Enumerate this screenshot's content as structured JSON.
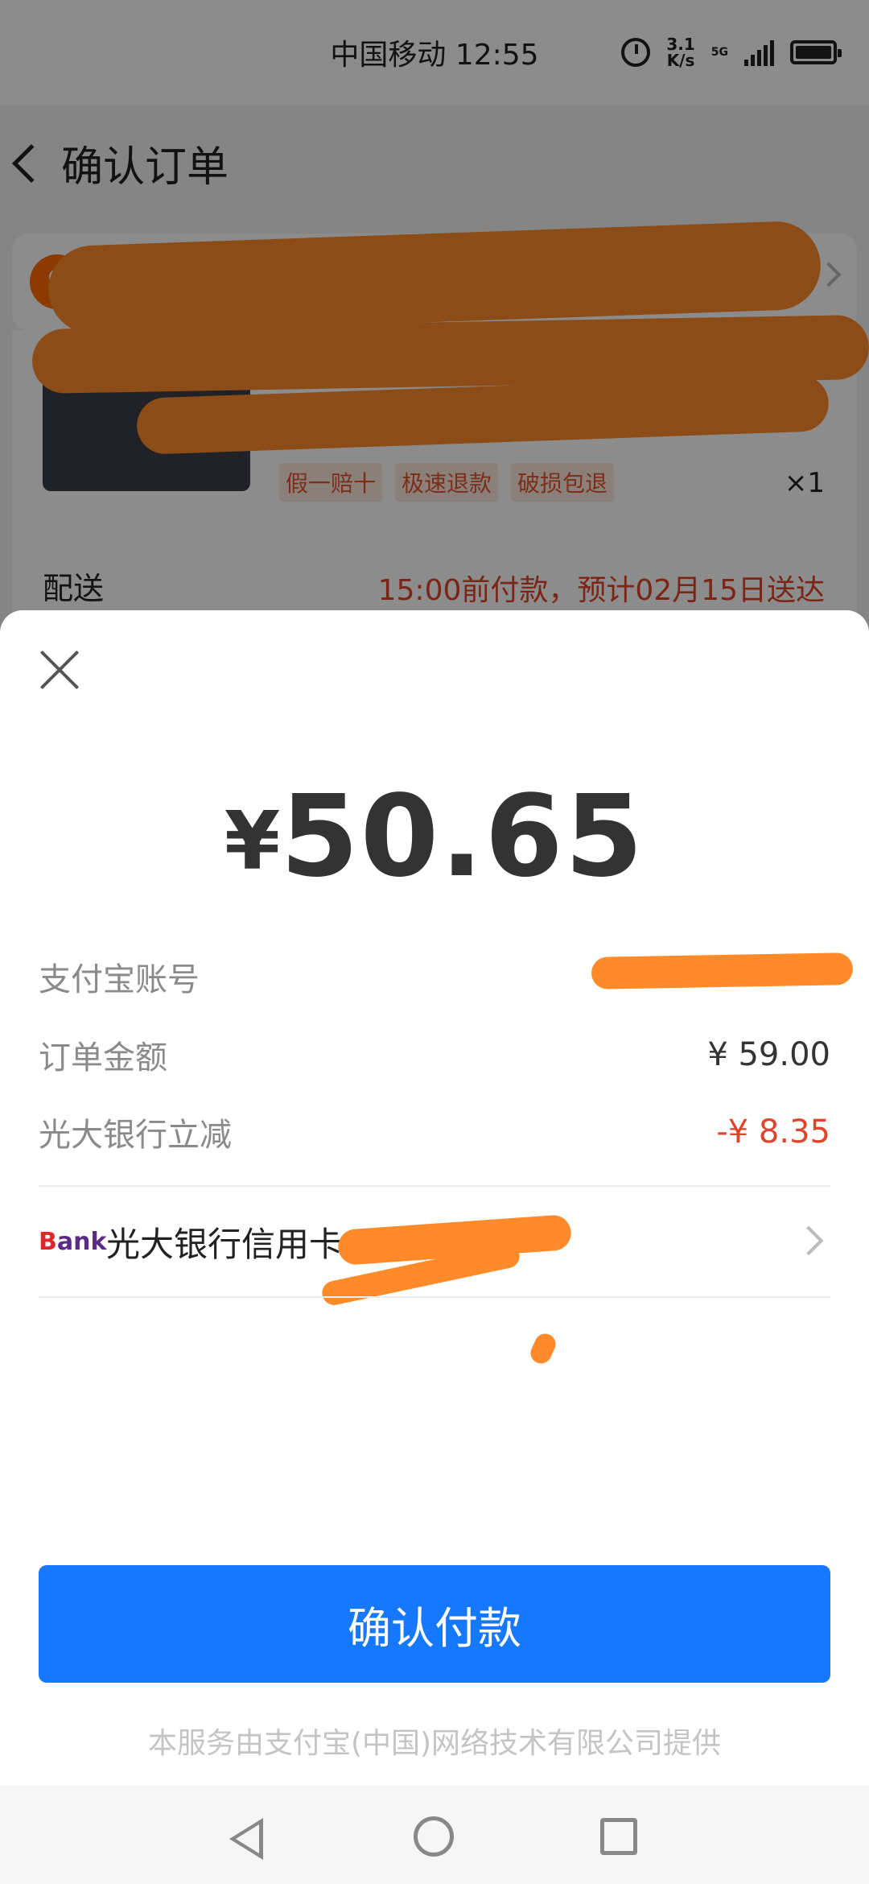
{
  "status_bar": {
    "carrier_time": "中国移动 12:55",
    "speed_value": "3.1",
    "speed_unit": "K/s",
    "network": "5G"
  },
  "order_page": {
    "title": "确认订单",
    "tags": [
      "假一赔十",
      "极速退款",
      "破损包退"
    ],
    "quantity": "×1",
    "shipping_label": "配送",
    "shipping_note": "15:00前付款，预计02月15日送达"
  },
  "payment": {
    "currency_symbol": "¥",
    "amount": "50.65",
    "account_label": "支付宝账号",
    "order_amount_label": "订单金额",
    "order_amount_value": "¥ 59.00",
    "discount_label": "光大银行立减",
    "discount_value": "-¥ 8.35",
    "bank_logo_b": "B",
    "bank_logo_rest": "ank",
    "method_name": "光大银行信用卡(",
    "confirm_button": "确认付款",
    "provider_note": "本服务由支付宝(中国)网络技术有限公司提供"
  },
  "colors": {
    "primary_button": "#1677ff",
    "discount_red": "#e0442a",
    "redaction_orange": "#ff8a2a"
  }
}
